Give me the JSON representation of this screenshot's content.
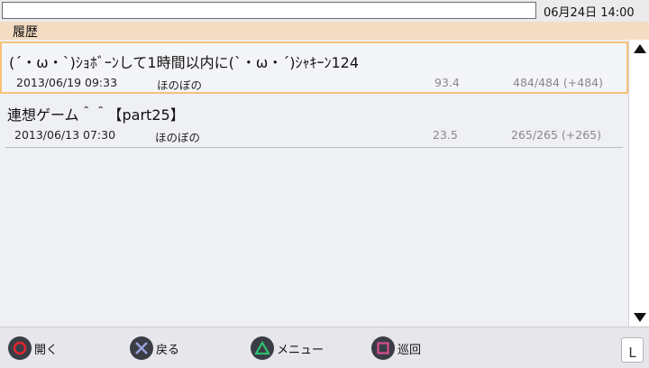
{
  "status_bar": {
    "search_value": "",
    "clock": "06月24日 14:00"
  },
  "section": {
    "title": "履歴"
  },
  "threads": [
    {
      "title": "(´・ω・`)ｼｮﾎﾞｰﾝして1時間以内に(`・ω・´)ｼｬｷｰﾝ124",
      "date": "2013/06/19 09:33",
      "board": "ほのぼの",
      "momentum": "93.4",
      "count": "484/484 (+484)",
      "selected": true
    },
    {
      "title": "連想ゲーム＾＾【part25】",
      "date": "2013/06/13 07:30",
      "board": "ほのぼの",
      "momentum": "23.5",
      "count": "265/265 (+265)",
      "selected": false
    }
  ],
  "bottom_bar": {
    "open_label": "開く",
    "back_label": "戻る",
    "menu_label": "メニュー",
    "patrol_label": "巡回",
    "l_label": "L"
  },
  "colors": {
    "header_bg": "#f4dcc2",
    "selection_border": "#f6c27a",
    "circle": "#e0262d",
    "cross": "#9aa1dd",
    "triangle": "#2fbf73",
    "square": "#d84c8c"
  }
}
